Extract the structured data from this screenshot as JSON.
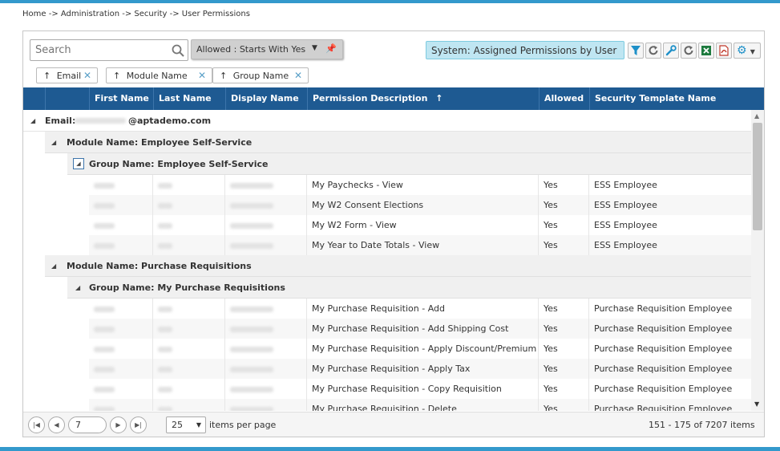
{
  "breadcrumb": "Home -> Administration -> Security -> User Permissions",
  "search": {
    "placeholder": "Search"
  },
  "filter_chip": {
    "label": "Allowed : Starts With Yes"
  },
  "system_view": {
    "label": "System: Assigned Permissions by User"
  },
  "group_chips": [
    {
      "label": "Email"
    },
    {
      "label": "Module Name"
    },
    {
      "label": "Group Name"
    }
  ],
  "columns": [
    "First Name",
    "Last Name",
    "Display Name",
    "Permission Description",
    "Allowed",
    "Security Template Name"
  ],
  "email_group": {
    "label": "Email:",
    "value": "@aptademo.com"
  },
  "modules": [
    {
      "label": "Module Name: Employee Self-Service",
      "group_label": "Group Name: Employee Self-Service",
      "rows": [
        {
          "desc": "My Paychecks - View",
          "allowed": "Yes",
          "template": "ESS Employee"
        },
        {
          "desc": "My W2 Consent Elections",
          "allowed": "Yes",
          "template": "ESS Employee"
        },
        {
          "desc": "My W2 Form - View",
          "allowed": "Yes",
          "template": "ESS Employee"
        },
        {
          "desc": "My Year to Date Totals - View",
          "allowed": "Yes",
          "template": "ESS Employee"
        }
      ]
    },
    {
      "label": "Module Name: Purchase Requisitions",
      "group_label": "Group Name: My Purchase Requisitions",
      "rows": [
        {
          "desc": "My Purchase Requisition - Add",
          "allowed": "Yes",
          "template": "Purchase Requisition Employee"
        },
        {
          "desc": "My Purchase Requisition - Add Shipping Cost",
          "allowed": "Yes",
          "template": "Purchase Requisition Employee"
        },
        {
          "desc": "My Purchase Requisition - Apply Discount/Premium",
          "allowed": "Yes",
          "template": "Purchase Requisition Employee"
        },
        {
          "desc": "My Purchase Requisition - Apply Tax",
          "allowed": "Yes",
          "template": "Purchase Requisition Employee"
        },
        {
          "desc": "My Purchase Requisition - Copy Requisition",
          "allowed": "Yes",
          "template": "Purchase Requisition Employee"
        },
        {
          "desc": "My Purchase Requisition - Delete",
          "allowed": "Yes",
          "template": "Purchase Requisition Employee"
        }
      ]
    }
  ],
  "pager": {
    "page": "7",
    "page_size": "25",
    "items_per_page_label": "items per page",
    "summary": "151 - 175 of 7207 items"
  },
  "colors": {
    "header": "#1e5a92",
    "accent": "#3399cc",
    "system_view_bg": "#bfe6f2"
  },
  "icons": [
    "search-icon",
    "pin-icon",
    "filter-icon",
    "refresh-icon",
    "wrench-icon",
    "excel-icon",
    "pdf-icon",
    "gear-icon",
    "sort-asc-icon",
    "close-icon",
    "collapse-icon"
  ]
}
